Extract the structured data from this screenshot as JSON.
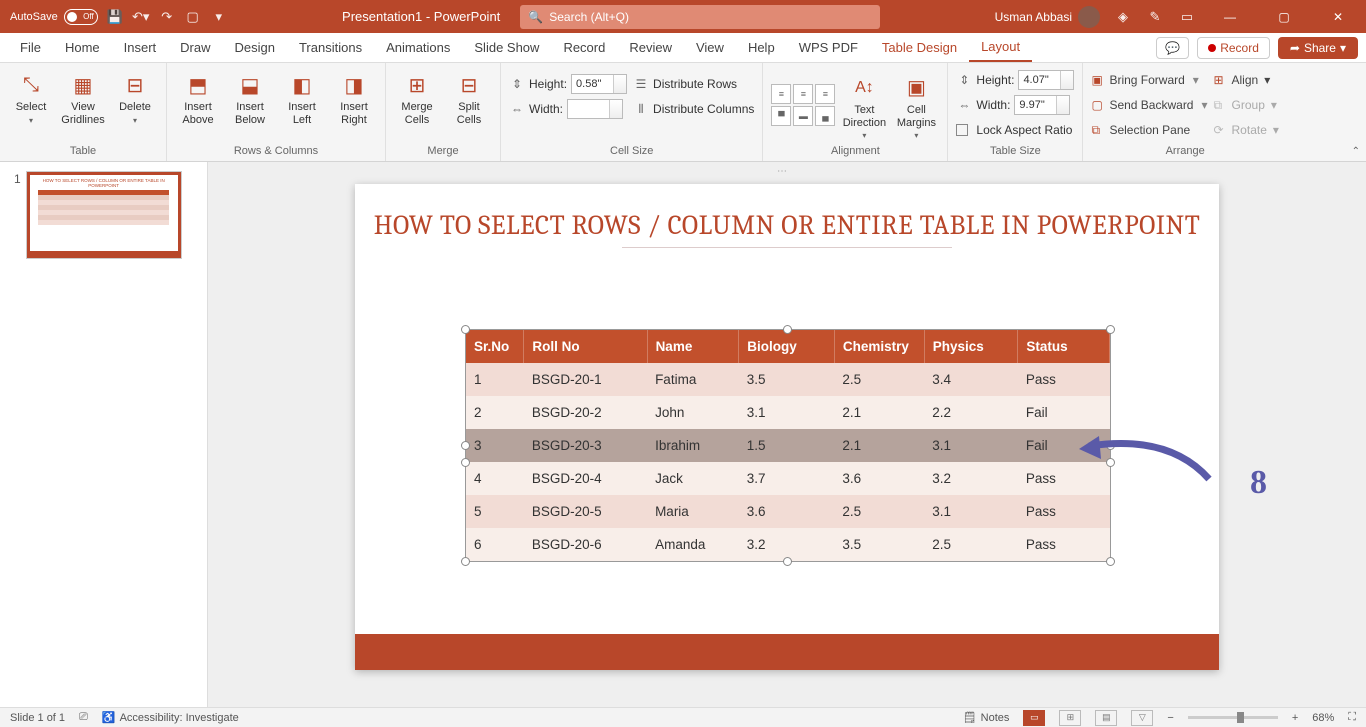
{
  "titlebar": {
    "autosave_label": "AutoSave",
    "autosave_state": "Off",
    "doc_title": "Presentation1 - PowerPoint",
    "search_placeholder": "Search (Alt+Q)",
    "user_name": "Usman Abbasi"
  },
  "menu": {
    "tabs": [
      "File",
      "Home",
      "Insert",
      "Draw",
      "Design",
      "Transitions",
      "Animations",
      "Slide Show",
      "Record",
      "Review",
      "View",
      "Help",
      "WPS PDF",
      "Table Design",
      "Layout"
    ],
    "active": "Layout",
    "record": "Record",
    "share": "Share"
  },
  "ribbon": {
    "groups": {
      "table": {
        "label": "Table",
        "select": "Select",
        "gridlines": "View\nGridlines",
        "delete": "Delete"
      },
      "rowscols": {
        "label": "Rows & Columns",
        "above": "Insert\nAbove",
        "below": "Insert\nBelow",
        "left": "Insert\nLeft",
        "right": "Insert\nRight"
      },
      "merge": {
        "label": "Merge",
        "merge": "Merge\nCells",
        "split": "Split\nCells"
      },
      "cellsize": {
        "label": "Cell Size",
        "height_lbl": "Height:",
        "height_val": "0.58\"",
        "width_lbl": "Width:",
        "width_val": "",
        "dist_rows": "Distribute Rows",
        "dist_cols": "Distribute Columns"
      },
      "alignment": {
        "label": "Alignment",
        "textdir": "Text\nDirection",
        "margins": "Cell\nMargins"
      },
      "tablesize": {
        "label": "Table Size",
        "height_lbl": "Height:",
        "height_val": "4.07\"",
        "width_lbl": "Width:",
        "width_val": "9.97\"",
        "lock": "Lock Aspect Ratio"
      },
      "arrange": {
        "label": "Arrange",
        "forward": "Bring Forward",
        "backward": "Send Backward",
        "pane": "Selection Pane",
        "align": "Align",
        "group": "Group",
        "rotate": "Rotate"
      }
    }
  },
  "slide": {
    "number": "1",
    "title": "HOW TO SELECT ROWS / COLUMN OR ENTIRE TABLE IN POWERPOINT",
    "table": {
      "headers": [
        "Sr.No",
        "Roll No",
        "Name",
        "Biology",
        "Chemistry",
        "Physics",
        "Status"
      ],
      "rows": [
        [
          "1",
          "BSGD-20-1",
          "Fatima",
          "3.5",
          "2.5",
          "3.4",
          "Pass"
        ],
        [
          "2",
          "BSGD-20-2",
          "John",
          "3.1",
          "2.1",
          "2.2",
          "Fail"
        ],
        [
          "3",
          "BSGD-20-3",
          "Ibrahim",
          "1.5",
          "2.1",
          "3.1",
          "Fail"
        ],
        [
          "4",
          "BSGD-20-4",
          "Jack",
          "3.7",
          "3.6",
          "3.2",
          "Pass"
        ],
        [
          "5",
          "BSGD-20-5",
          "Maria",
          "3.6",
          "2.5",
          "3.1",
          "Pass"
        ],
        [
          "6",
          "BSGD-20-6",
          "Amanda",
          "3.2",
          "3.5",
          "2.5",
          "Pass"
        ]
      ],
      "selected_row_index": 2
    },
    "annotation_number": "8"
  },
  "statusbar": {
    "slide_info": "Slide 1 of 1",
    "accessibility": "Accessibility: Investigate",
    "notes": "Notes",
    "zoom": "68%"
  }
}
